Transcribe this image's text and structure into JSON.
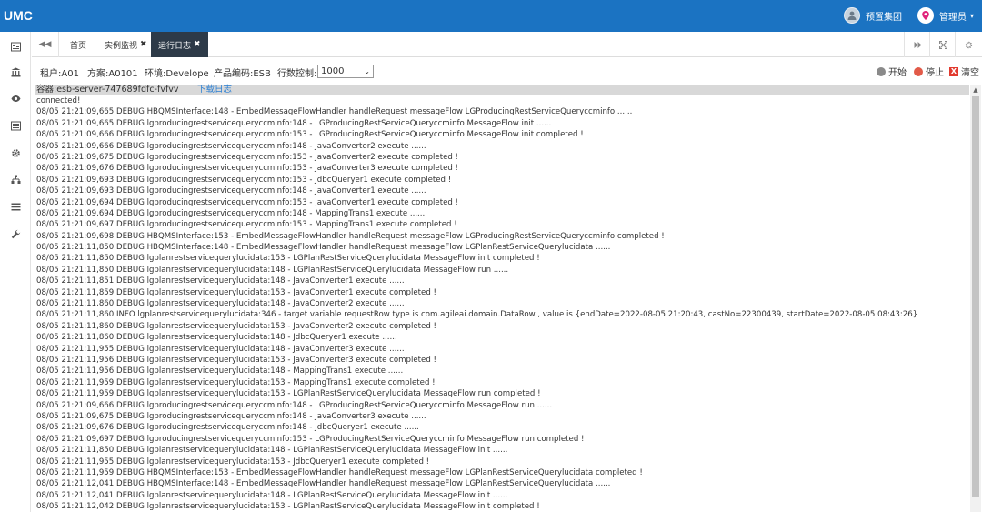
{
  "app": {
    "logo": "UMC"
  },
  "header": {
    "org_name": "预置集团",
    "user_name": "管理员",
    "caret": "▾",
    "colors": {
      "bar": "#1b73c2",
      "pin": "#e0237a"
    }
  },
  "sidebar": {
    "icons": [
      "dashboard-icon",
      "bank-icon",
      "eye-icon",
      "server-icon",
      "gear-icon",
      "sitemap-icon",
      "list-icon",
      "wrench-icon"
    ]
  },
  "tabs": {
    "back_glyph": "◀◀",
    "items": [
      {
        "label": "首页",
        "closable": false
      },
      {
        "label": "实例监视",
        "closable": true
      },
      {
        "label": "运行日志",
        "closable": true,
        "active": true
      }
    ],
    "close_glyph": "✖",
    "right_icons": [
      "forward-icon",
      "fullscreen-icon",
      "settings-icon"
    ]
  },
  "toolbar": {
    "tenant": "租户:A01",
    "scheme": "方案:A0101",
    "environment": "环境:Develope",
    "product": "产品编码:ESB",
    "rows_label": "行数控制:",
    "rows_value": "1000",
    "select_arrow": "⌄",
    "start": "开始",
    "stop": "停止",
    "clear": "清空",
    "clear_glyph": "X",
    "colors": {
      "start": "#8a8a8a",
      "stop": "#e25a48",
      "clear": "#e23a2f"
    }
  },
  "log": {
    "container": "容器:esb-server-747689fdfc-fvfvv",
    "download": "下载日志",
    "lines": [
      "connected!",
      "08/05 21:21:09,665 DEBUG HBQMSInterface:148 - EmbedMessageFlowHandler handleRequest messageFlow LGProducingRestServiceQueryccminfo ......",
      "08/05 21:21:09,665 DEBUG lgproducingrestservicequeryccminfo:148 - LGProducingRestServiceQueryccminfo MessageFlow init ......",
      "08/05 21:21:09,666 DEBUG lgproducingrestservicequeryccminfo:153 - LGProducingRestServiceQueryccminfo MessageFlow init completed !",
      "08/05 21:21:09,666 DEBUG lgproducingrestservicequeryccminfo:148 - JavaConverter2 execute ......",
      "08/05 21:21:09,675 DEBUG lgproducingrestservicequeryccminfo:153 - JavaConverter2 execute completed !",
      "08/05 21:21:09,676 DEBUG lgproducingrestservicequeryccminfo:153 - JavaConverter3 execute completed !",
      "08/05 21:21:09,693 DEBUG lgproducingrestservicequeryccminfo:153 - JdbcQueryer1 execute completed !",
      "08/05 21:21:09,693 DEBUG lgproducingrestservicequeryccminfo:148 - JavaConverter1 execute ......",
      "08/05 21:21:09,694 DEBUG lgproducingrestservicequeryccminfo:153 - JavaConverter1 execute completed !",
      "08/05 21:21:09,694 DEBUG lgproducingrestservicequeryccminfo:148 - MappingTrans1 execute ......",
      "08/05 21:21:09,697 DEBUG lgproducingrestservicequeryccminfo:153 - MappingTrans1 execute completed !",
      "08/05 21:21:09,698 DEBUG HBQMSInterface:153 - EmbedMessageFlowHandler handleRequest messageFlow LGProducingRestServiceQueryccminfo completed !",
      "08/05 21:21:11,850 DEBUG HBQMSInterface:148 - EmbedMessageFlowHandler handleRequest messageFlow LGPlanRestServiceQuerylucidata ......",
      "08/05 21:21:11,850 DEBUG lgplanrestservicequerylucidata:153 - LGPlanRestServiceQuerylucidata MessageFlow init completed !",
      "08/05 21:21:11,850 DEBUG lgplanrestservicequerylucidata:148 - LGPlanRestServiceQuerylucidata MessageFlow run ......",
      "08/05 21:21:11,851 DEBUG lgplanrestservicequerylucidata:148 - JavaConverter1 execute ......",
      "08/05 21:21:11,859 DEBUG lgplanrestservicequerylucidata:153 - JavaConverter1 execute completed !",
      "08/05 21:21:11,860 DEBUG lgplanrestservicequerylucidata:148 - JavaConverter2 execute ......",
      "08/05 21:21:11,860 INFO lgplanrestservicequerylucidata:346 - target variable requestRow type is com.agileai.domain.DataRow , value is {endDate=2022-08-05 21:20:43, castNo=22300439, startDate=2022-08-05 08:43:26}",
      "08/05 21:21:11,860 DEBUG lgplanrestservicequerylucidata:153 - JavaConverter2 execute completed !",
      "08/05 21:21:11,860 DEBUG lgplanrestservicequerylucidata:148 - JdbcQueryer1 execute ......",
      "08/05 21:21:11,955 DEBUG lgplanrestservicequerylucidata:148 - JavaConverter3 execute ......",
      "08/05 21:21:11,956 DEBUG lgplanrestservicequerylucidata:153 - JavaConverter3 execute completed !",
      "08/05 21:21:11,956 DEBUG lgplanrestservicequerylucidata:148 - MappingTrans1 execute ......",
      "08/05 21:21:11,959 DEBUG lgplanrestservicequerylucidata:153 - MappingTrans1 execute completed !",
      "08/05 21:21:11,959 DEBUG lgplanrestservicequerylucidata:153 - LGPlanRestServiceQuerylucidata MessageFlow run completed !",
      "08/05 21:21:09,666 DEBUG lgproducingrestservicequeryccminfo:148 - LGProducingRestServiceQueryccminfo MessageFlow run ......",
      "08/05 21:21:09,675 DEBUG lgproducingrestservicequeryccminfo:148 - JavaConverter3 execute ......",
      "08/05 21:21:09,676 DEBUG lgproducingrestservicequeryccminfo:148 - JdbcQueryer1 execute ......",
      "08/05 21:21:09,697 DEBUG lgproducingrestservicequeryccminfo:153 - LGProducingRestServiceQueryccminfo MessageFlow run completed !",
      "08/05 21:21:11,850 DEBUG lgplanrestservicequerylucidata:148 - LGPlanRestServiceQuerylucidata MessageFlow init ......",
      "08/05 21:21:11,955 DEBUG lgplanrestservicequerylucidata:153 - JdbcQueryer1 execute completed !",
      "08/05 21:21:11,959 DEBUG HBQMSInterface:153 - EmbedMessageFlowHandler handleRequest messageFlow LGPlanRestServiceQuerylucidata completed !",
      "08/05 21:21:12,041 DEBUG HBQMSInterface:148 - EmbedMessageFlowHandler handleRequest messageFlow LGPlanRestServiceQuerylucidata ......",
      "08/05 21:21:12,041 DEBUG lgplanrestservicequerylucidata:148 - LGPlanRestServiceQuerylucidata MessageFlow init ......",
      "08/05 21:21:12,042 DEBUG lgplanrestservicequerylucidata:153 - LGPlanRestServiceQuerylucidata MessageFlow init completed !"
    ]
  },
  "scrollbar": {
    "up_glyph": "▲"
  }
}
